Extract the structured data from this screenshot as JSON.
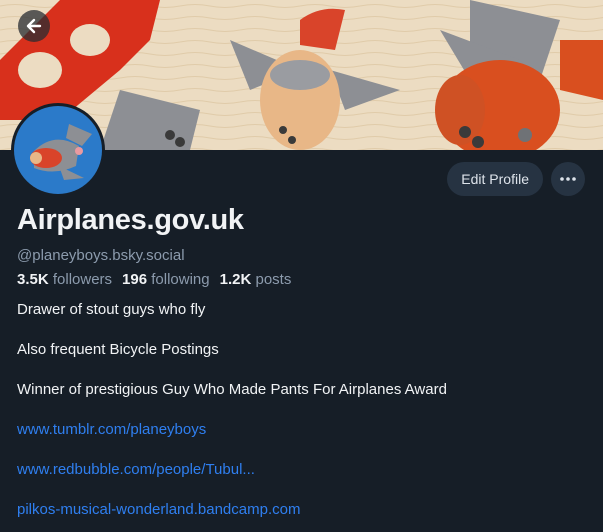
{
  "profile": {
    "display_name": "Airplanes.gov.uk",
    "handle": "@planeyboys.bsky.social",
    "followers_count": "3.5K",
    "followers_label": "followers",
    "following_count": "196",
    "following_label": "following",
    "posts_count": "1.2K",
    "posts_label": "posts"
  },
  "actions": {
    "edit_profile": "Edit Profile",
    "more_label": "···"
  },
  "bio": [
    "Drawer of stout guys who fly",
    "Also frequent Bicycle Postings",
    "Winner of prestigious Guy Who Made Pants For Airplanes Award"
  ],
  "links": [
    "www.tumblr.com/planeyboys",
    "www.redbubble.com/people/Tubul...",
    "pilkos-musical-wonderland.bandcamp.com"
  ],
  "colors": {
    "background": "#161e27",
    "link": "#2f7ff0",
    "muted": "#8c9bad",
    "button_bg": "#263342"
  },
  "icons": {
    "back": "arrow-left-icon",
    "more": "ellipsis-icon"
  }
}
